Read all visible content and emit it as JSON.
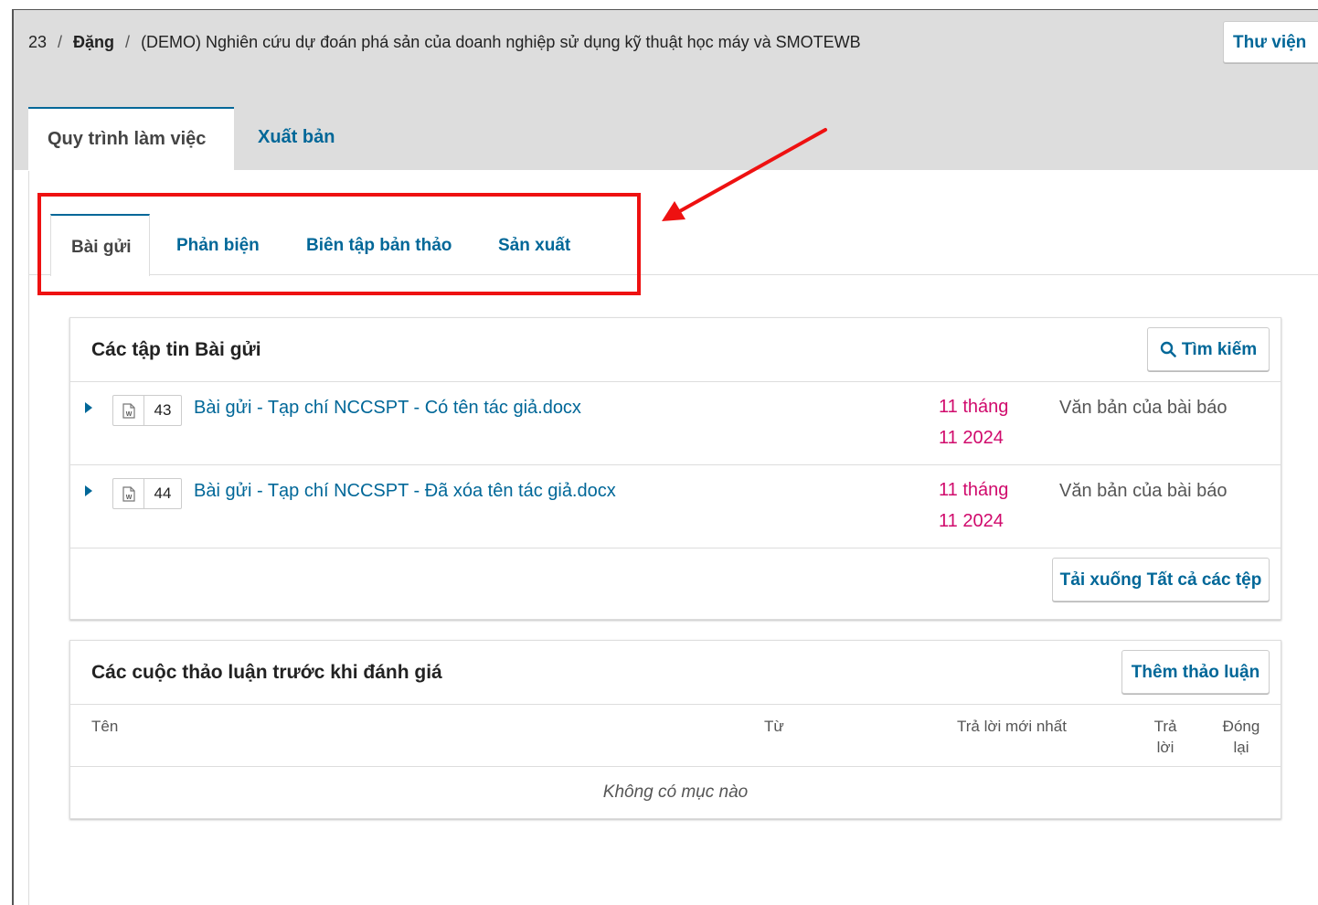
{
  "breadcrumb": {
    "id": "23",
    "author": "Đặng",
    "title": "(DEMO) Nghiên cứu dự đoán phá sản của doanh nghiệp sử dụng kỹ thuật học máy và SMOTEWB"
  },
  "header": {
    "library_label": "Thư viện"
  },
  "main_tabs": [
    {
      "label": "Quy trình làm việc",
      "active": true
    },
    {
      "label": "Xuất bản",
      "active": false
    }
  ],
  "sub_tabs": [
    {
      "label": "Bài gửi",
      "active": true
    },
    {
      "label": "Phản biện",
      "active": false
    },
    {
      "label": "Biên tập bản thảo",
      "active": false
    },
    {
      "label": "Sản xuất",
      "active": false
    }
  ],
  "files_panel": {
    "title": "Các tập tin Bài gửi",
    "search_label": "Tìm kiếm",
    "files": [
      {
        "id": "43",
        "name": "Bài gửi - Tạp chí NCCSPT - Có tên tác giả.docx",
        "date_line1": "11 tháng",
        "date_line2": "11 2024",
        "type": "Văn bản của bài báo"
      },
      {
        "id": "44",
        "name": "Bài gửi - Tạp chí NCCSPT - Đã xóa tên tác giả.docx",
        "date_line1": "11 tháng",
        "date_line2": "11 2024",
        "type": "Văn bản của bài báo"
      }
    ],
    "download_all_label": "Tải xuống Tất cả các tệp"
  },
  "discussion_panel": {
    "title": "Các cuộc thảo luận trước khi đánh giá",
    "add_label": "Thêm thảo luận",
    "columns": {
      "name": "Tên",
      "from": "Từ",
      "last_reply": "Trả lời mới nhất",
      "replies_1": "Trả",
      "replies_2": "lời",
      "closed_1": "Đóng",
      "closed_2": "lại"
    },
    "empty_text": "Không có mục nào"
  },
  "colors": {
    "link": "#006798",
    "date": "#d00a6c",
    "highlight": "#ee1111"
  }
}
